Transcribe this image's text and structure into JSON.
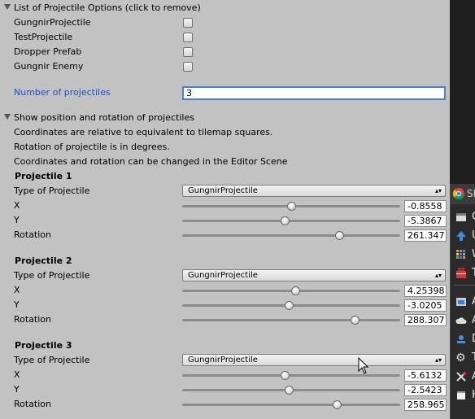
{
  "options_header": "List of Projectile Options (click to remove)",
  "options": [
    {
      "label": "GungnirProjectile",
      "checked": false
    },
    {
      "label": "TestProjectile",
      "checked": false
    },
    {
      "label": "Dropper Prefab",
      "checked": false
    },
    {
      "label": "Gungnir Enemy",
      "checked": false
    }
  ],
  "number_label": "Number of projectiles",
  "number_value": "3",
  "show_header": "Show position and rotation of projectiles",
  "info": [
    "Coordinates are relative to equivalent to tilemap squares.",
    "Rotation of projectile is in degrees.",
    "Coordinates and rotation can be changed in the Editor Scene"
  ],
  "type_label": "Type of Projectile",
  "x_label": "X",
  "y_label": "Y",
  "rotation_label": "Rotation",
  "projectiles": [
    {
      "title": "Projectile 1",
      "type": "GungnirProjectile",
      "x": "-0.8558",
      "y": "-5.3867",
      "rotation": "261.347",
      "x_fill": 0.5,
      "y_fill": 0.47,
      "rot_fill": 0.72
    },
    {
      "title": "Projectile 2",
      "type": "GungnirProjectile",
      "x": "4.25398",
      "y": "-3.0205",
      "rotation": "288.307",
      "x_fill": 0.52,
      "y_fill": 0.49,
      "rot_fill": 0.79
    },
    {
      "title": "Projectile 3",
      "type": "GungnirProjectile",
      "x": "-5.6132",
      "y": "-2.5423",
      "rotation": "258.965",
      "x_fill": 0.47,
      "y_fill": 0.49,
      "rot_fill": 0.71
    }
  ],
  "side_menu": {
    "top_label": "SI",
    "items": [
      {
        "icon": "chrome-icon",
        "text": ""
      },
      {
        "icon": "window-icon",
        "text": "G"
      },
      {
        "icon": "arrow-up-icon",
        "text": "U"
      },
      {
        "icon": "grid-icon",
        "text": "W"
      },
      {
        "icon": "toolbox-icon",
        "text": "T"
      },
      {
        "icon": "cloud-icon",
        "text": "A"
      },
      {
        "icon": "cloud-icon",
        "text": "A"
      },
      {
        "icon": "stamp-icon",
        "text": "D"
      },
      {
        "icon": "gear-icon",
        "text": "T"
      },
      {
        "icon": "tools-icon",
        "text": "A"
      },
      {
        "icon": "window-icon",
        "text": "H"
      }
    ]
  },
  "colors": {
    "panel_bg": "#c2c2c2",
    "link_blue": "#1a4fd0",
    "focus_border": "#4b7fd6"
  }
}
